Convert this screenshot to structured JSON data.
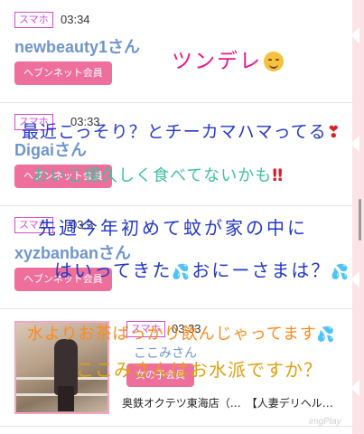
{
  "posts": [
    {
      "badge": "スマホ",
      "time": "03:34",
      "user": "newbeauty1さん",
      "pill": "ヘブンネット会員"
    },
    {
      "badge": "スマホ",
      "time": "03:33",
      "user": "Digaiさん",
      "pill": "ヘブンネット会員"
    },
    {
      "badge": "スマホ",
      "time": "03:3",
      "user": "xyzbanbanさん",
      "pill": "ヘブンネット会員"
    },
    {
      "badge": "スマホ",
      "time": "03:33",
      "user": "ここみさん",
      "pill": "女の子会員",
      "shop": "奥鉄オクテツ東海店（…　【人妻デリヘル…"
    }
  ],
  "overlays": {
    "line1": "ツンデレ",
    "line2": "最近こっそり？とチーカマハマってる",
    "line3": "おいこ様久しく食べてないかも",
    "line4": "先週今年初めて蚊が家の中に",
    "line5a": "はいってきた",
    "line5b": "おにーさまは？",
    "line6": "水よりお茶ばっかり飲んじゃってます",
    "line7": "ここみさんはお水派ですか？"
  },
  "icons": {
    "smile": "relieved-face-icon",
    "heart": "heart-exclamation-icon",
    "bang": "double-exclamation-icon",
    "sweat": "sweat-droplets-icon"
  },
  "watermark": "imgPlay",
  "colors": {
    "badge": "#d24bd2",
    "username": "#6f95cf",
    "pill": "#ef6f9c",
    "accent_strip": "#fbe3e8"
  }
}
